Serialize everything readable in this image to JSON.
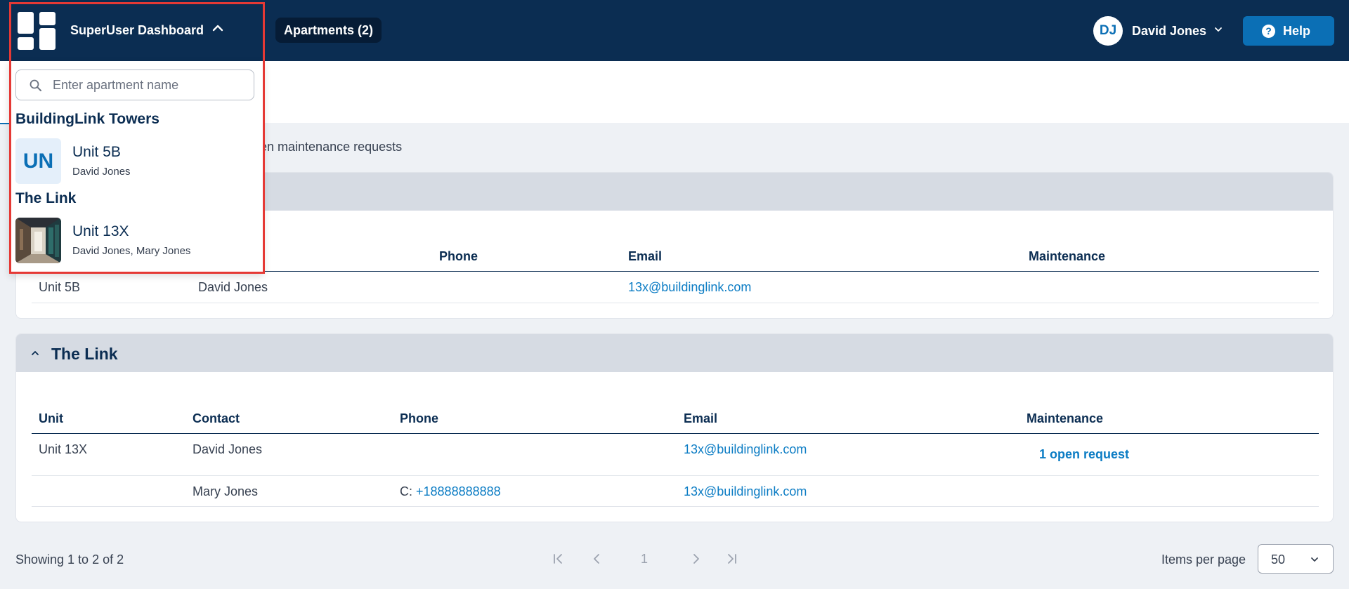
{
  "header": {
    "dashboard_title": "SuperUser Dashboard",
    "apartments_label": "Apartments (2)",
    "user_initials": "DJ",
    "user_name": "David Jones",
    "help_label": "Help"
  },
  "summary_text": "pen maintenance requests",
  "dropdown": {
    "search_placeholder": "Enter apartment name",
    "groups": [
      {
        "name": "BuildingLink Towers",
        "units": [
          {
            "initials": "UN",
            "name": "Unit 5B",
            "residents": "David Jones"
          }
        ]
      },
      {
        "name": "The Link",
        "units": [
          {
            "name": "Unit 13X",
            "residents": "David Jones, Mary Jones"
          }
        ]
      }
    ]
  },
  "building_cards": [
    {
      "visible_headers": [
        "Phone",
        "Email",
        "Maintenance"
      ],
      "rows": [
        {
          "unit": "Unit 5B",
          "contact": "David Jones",
          "phone_prefix": "",
          "phone": "",
          "email": "13x@buildinglink.com",
          "maintenance": ""
        }
      ]
    },
    {
      "name": "The Link",
      "headers": [
        "Unit",
        "Contact",
        "Phone",
        "Email",
        "Maintenance"
      ],
      "rows": [
        {
          "unit": "Unit 13X",
          "contact": "David Jones",
          "phone_prefix": "",
          "phone": "",
          "email": "13x@buildinglink.com",
          "maintenance": "1 open request"
        },
        {
          "unit": "",
          "contact": "Mary Jones",
          "phone_prefix": "C: ",
          "phone": "+18888888888",
          "email": "13x@buildinglink.com",
          "maintenance": ""
        }
      ]
    }
  ],
  "pagination": {
    "showing": "Showing 1 to 2 of 2",
    "current_page": "1",
    "items_per_page_label": "Items per page",
    "items_per_page_value": "50"
  },
  "colors": {
    "header_bg": "#0b2d52",
    "accent": "#0b6fb5",
    "link": "#0b7cc4",
    "highlight": "#e53935"
  },
  "icons": [
    "grid-logo-icon",
    "chevron-up-icon",
    "chevron-down-icon",
    "help-icon",
    "search-icon",
    "first-page-icon",
    "prev-page-icon",
    "next-page-icon",
    "last-page-icon"
  ]
}
